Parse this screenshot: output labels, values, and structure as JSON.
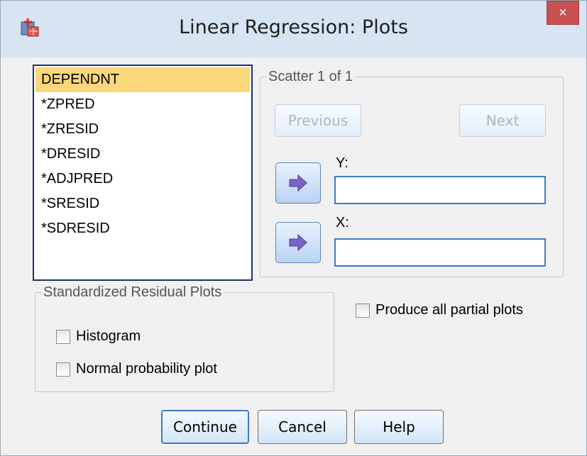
{
  "window": {
    "title": "Linear Regression: Plots",
    "close_label": "×"
  },
  "variables": [
    {
      "label": "DEPENDNT",
      "selected": true
    },
    {
      "label": "*ZPRED"
    },
    {
      "label": "*ZRESID"
    },
    {
      "label": "*DRESID"
    },
    {
      "label": "*ADJPRED"
    },
    {
      "label": "*SRESID"
    },
    {
      "label": "*SDRESID"
    }
  ],
  "scatter": {
    "legend": "Scatter 1 of 1",
    "previous_label": "Previous",
    "next_label": "Next",
    "y_label": "Y:",
    "x_label": "X:",
    "y_value": "",
    "x_value": ""
  },
  "std_residual": {
    "legend": "Standardized Residual Plots",
    "histogram_label": "Histogram",
    "normal_label": "Normal probability plot",
    "histogram_checked": false,
    "normal_checked": false
  },
  "partial_plots": {
    "label": "Produce all partial plots",
    "checked": false
  },
  "buttons": {
    "continue_label": "Continue",
    "cancel_label": "Cancel",
    "help_label": "Help"
  },
  "colors": {
    "selected_item": "#fad77a",
    "title_bar": "#d7e4f2",
    "close_button": "#c75050",
    "accent_border": "#3f7bc4",
    "list_border": "#1e3264"
  },
  "icons": {
    "app": "spss-dialog-icon",
    "arrow": "right-arrow-icon",
    "close": "close-icon"
  }
}
